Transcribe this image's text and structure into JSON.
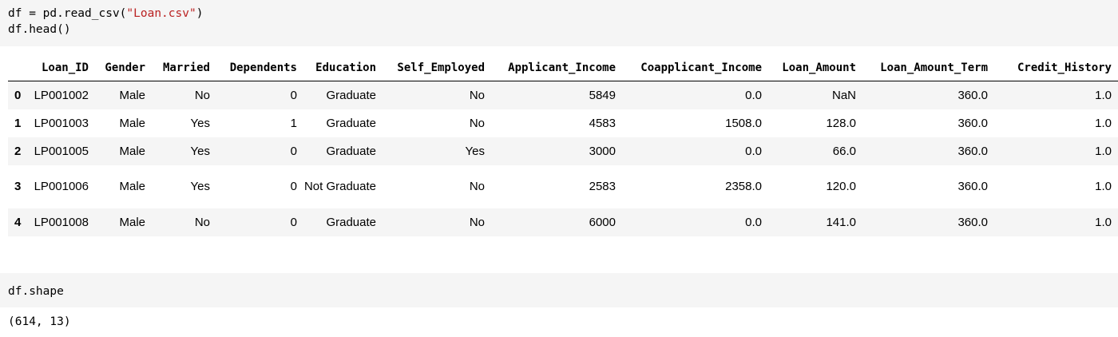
{
  "cell1": {
    "line1_prefix": "df = pd.read_csv(",
    "line1_string": "\"Loan.csv\"",
    "line1_suffix": ")",
    "line2": "df.head()"
  },
  "dataframe": {
    "columns": [
      "Loan_ID",
      "Gender",
      "Married",
      "Dependents",
      "Education",
      "Self_Employed",
      "Applicant_Income",
      "Coapplicant_Income",
      "Loan_Amount",
      "Loan_Amount_Term",
      "Credit_History"
    ],
    "rows": [
      {
        "index": "0",
        "cells": [
          "LP001002",
          "Male",
          "No",
          "0",
          "Graduate",
          "No",
          "5849",
          "0.0",
          "NaN",
          "360.0",
          "1.0"
        ]
      },
      {
        "index": "1",
        "cells": [
          "LP001003",
          "Male",
          "Yes",
          "1",
          "Graduate",
          "No",
          "4583",
          "1508.0",
          "128.0",
          "360.0",
          "1.0"
        ]
      },
      {
        "index": "2",
        "cells": [
          "LP001005",
          "Male",
          "Yes",
          "0",
          "Graduate",
          "Yes",
          "3000",
          "0.0",
          "66.0",
          "360.0",
          "1.0"
        ]
      },
      {
        "index": "3",
        "cells": [
          "LP001006",
          "Male",
          "Yes",
          "0",
          "Not Graduate",
          "No",
          "2583",
          "2358.0",
          "120.0",
          "360.0",
          "1.0"
        ]
      },
      {
        "index": "4",
        "cells": [
          "LP001008",
          "Male",
          "No",
          "0",
          "Graduate",
          "No",
          "6000",
          "0.0",
          "141.0",
          "360.0",
          "1.0"
        ]
      }
    ]
  },
  "cell2": {
    "code": "df.shape",
    "output": "(614, 13)"
  }
}
